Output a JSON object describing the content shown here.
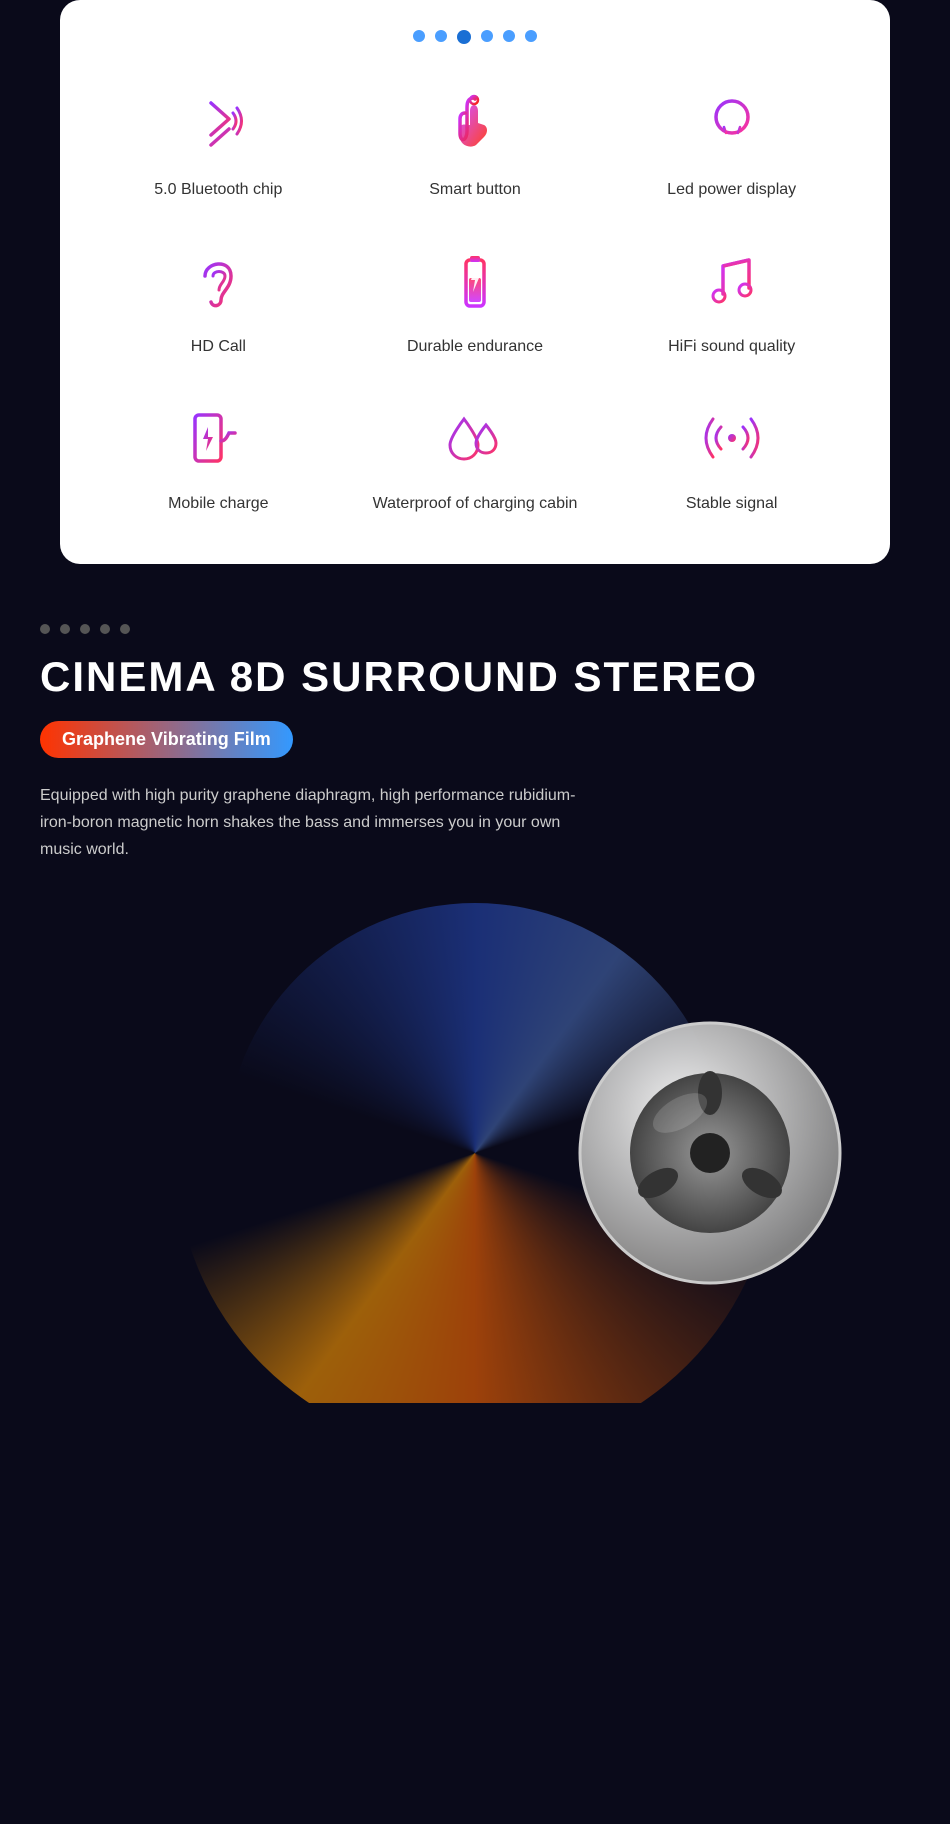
{
  "carousel_dots": [
    {
      "active": false
    },
    {
      "active": false
    },
    {
      "active": true
    },
    {
      "active": false
    },
    {
      "active": false
    },
    {
      "active": false
    }
  ],
  "features_row1": [
    {
      "id": "bluetooth",
      "label": "5.0 Bluetooth chip",
      "icon": "bluetooth"
    },
    {
      "id": "smart-button",
      "label": "Smart button",
      "icon": "touch"
    },
    {
      "id": "led-power",
      "label": "Led power display",
      "icon": "bulb"
    }
  ],
  "features_row2": [
    {
      "id": "hd-call",
      "label": "HD Call",
      "icon": "ear"
    },
    {
      "id": "durable",
      "label": "Durable endurance",
      "icon": "battery"
    },
    {
      "id": "hifi",
      "label": "HiFi sound quality",
      "icon": "music"
    }
  ],
  "features_row3": [
    {
      "id": "mobile-charge",
      "label": "Mobile charge",
      "icon": "charge"
    },
    {
      "id": "waterproof",
      "label": "Waterproof of charging cabin",
      "icon": "water"
    },
    {
      "id": "stable-signal",
      "label": "Stable signal",
      "icon": "signal"
    }
  ],
  "dark_section": {
    "dots_count": 5,
    "title": "CINEMA 8D SURROUND STEREO",
    "badge": "Graphene Vibrating Film",
    "description": "Equipped with high purity graphene diaphragm, high performance rubidium-iron-boron magnetic horn shakes the bass and immerses you in your own music world."
  }
}
